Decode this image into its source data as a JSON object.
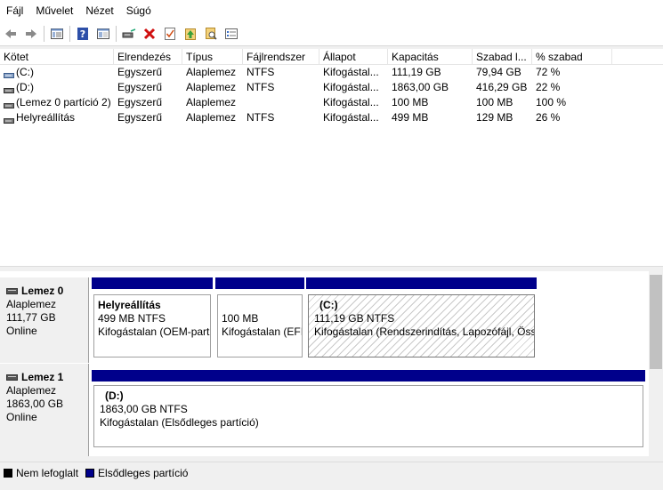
{
  "menu": [
    "Fájl",
    "Művelet",
    "Nézet",
    "Súgó"
  ],
  "toolbar": {
    "icons": [
      "back-arrow-icon",
      "forward-arrow-icon",
      "console-tree-icon",
      "help-icon",
      "properties-icon",
      "connect-drive-icon",
      "delete-icon",
      "check-icon",
      "up-arrow-icon",
      "search-icon",
      "list-icon"
    ]
  },
  "volumes": {
    "headers": [
      "Kötet",
      "Elrendezés",
      "Típus",
      "Fájlrendszer",
      "Állapot",
      "Kapacitás",
      "Szabad l...",
      "% szabad"
    ],
    "rows": [
      [
        "(C:)",
        "Egyszerű",
        "Alaplemez",
        "NTFS",
        "Kifogástal...",
        "111,19 GB",
        "79,94 GB",
        "72 %"
      ],
      [
        "(D:)",
        "Egyszerű",
        "Alaplemez",
        "NTFS",
        "Kifogástal...",
        "1863,00 GB",
        "416,29 GB",
        "22 %"
      ],
      [
        "(Lemez 0 partíció 2)",
        "Egyszerű",
        "Alaplemez",
        "",
        "Kifogástal...",
        "100 MB",
        "100 MB",
        "100 %"
      ],
      [
        "Helyreállítás",
        "Egyszerű",
        "Alaplemez",
        "NTFS",
        "Kifogástal...",
        "499 MB",
        "129 MB",
        "26 %"
      ]
    ]
  },
  "disks": [
    {
      "name": "Lemez 0",
      "type": "Alaplemez",
      "size": "111,77 GB",
      "status": "Online",
      "partitions": [
        {
          "name": "Helyreállítás",
          "line1": "499 MB NTFS",
          "line2": "Kifogástalan (OEM-part"
        },
        {
          "name": "",
          "line1": "100 MB",
          "line2": "Kifogástalan (EFI"
        },
        {
          "name": "(C:)",
          "line1": "111,19 GB NTFS",
          "line2": "Kifogástalan (Rendszerindítás, Lapozófájl, Össz"
        }
      ]
    },
    {
      "name": "Lemez 1",
      "type": "Alaplemez",
      "size": "1863,00 GB",
      "status": "Online",
      "partitions": [
        {
          "name": "(D:)",
          "line1": "1863,00 GB NTFS",
          "line2": "Kifogástalan (Elsődleges partíció)"
        }
      ]
    }
  ],
  "legend": [
    {
      "label": "Nem lefoglalt",
      "color": "#000000"
    },
    {
      "label": "Elsődleges partíció",
      "color": "#00008b"
    }
  ]
}
